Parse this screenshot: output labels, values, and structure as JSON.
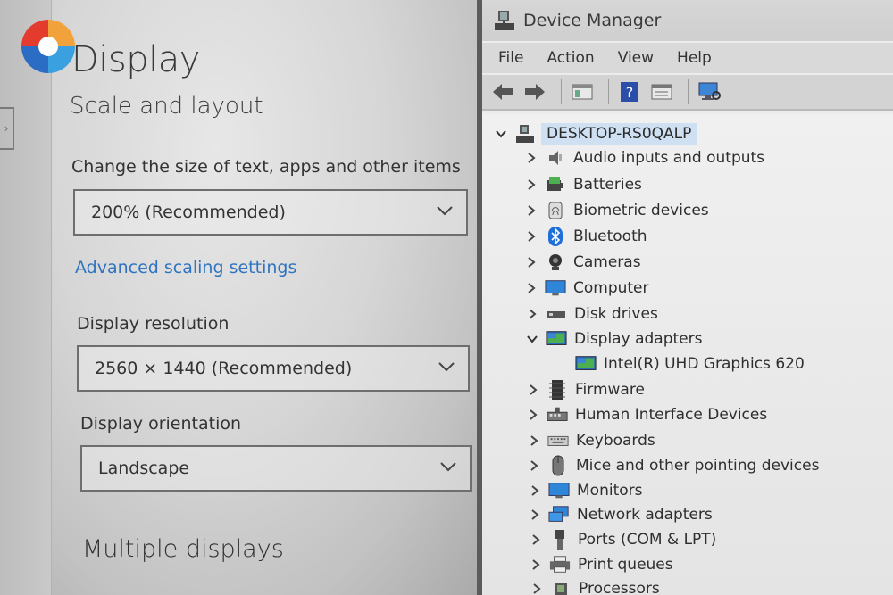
{
  "settings": {
    "page_title": "Display",
    "section_title": "Scale and layout",
    "scale_label": "Change the size of text, apps and other items",
    "scale_value": "200% (Recommended)",
    "advanced_link": "Advanced scaling settings",
    "resolution_label": "Display resolution",
    "resolution_value": "2560 × 1440 (Recommended)",
    "orientation_label": "Display orientation",
    "orientation_value": "Landscape",
    "multiple_displays": "Multiple displays"
  },
  "device_manager": {
    "title": "Device Manager",
    "menu": [
      "File",
      "Action",
      "View",
      "Help"
    ],
    "root": "DESKTOP-RS0QALP",
    "categories": [
      "Audio inputs and outputs",
      "Batteries",
      "Biometric devices",
      "Bluetooth",
      "Cameras",
      "Computer",
      "Disk drives",
      "Display adapters",
      "Intel(R) UHD Graphics 620",
      "Firmware",
      "Human Interface Devices",
      "Keyboards",
      "Mice and other pointing devices",
      "Monitors",
      "Network adapters",
      "Ports (COM & LPT)",
      "Print queues",
      "Processors"
    ],
    "icons": [
      "speaker-icon",
      "battery-icon",
      "fingerprint-icon",
      "bluetooth-icon",
      "camera-icon",
      "computer-icon",
      "disk-drive-icon",
      "display-adapter-icon",
      "display-adapter-icon",
      "firmware-icon",
      "hid-icon",
      "keyboard-icon",
      "mouse-icon",
      "monitor-icon",
      "network-adapter-icon",
      "port-icon",
      "printer-icon",
      "processor-icon"
    ],
    "accent_colors": {
      "selection": "#cfe0f3",
      "link": "#2e74c0",
      "bluetooth": "#1e6fd9"
    }
  }
}
